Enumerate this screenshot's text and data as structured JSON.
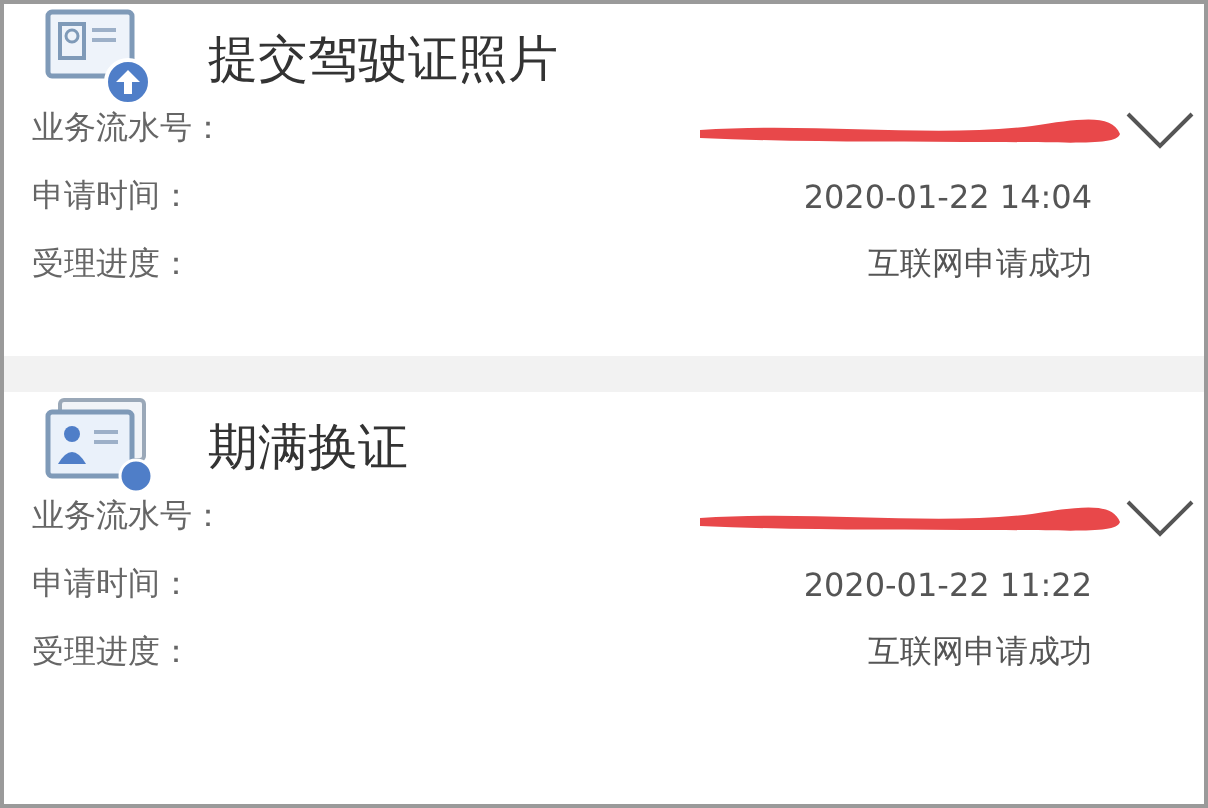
{
  "records": [
    {
      "kind": "upload",
      "title": "提交驾驶证照片",
      "expanded": false,
      "fields": [
        {
          "label": "业务流水号：",
          "value_hidden": true
        },
        {
          "label": "申请时间：",
          "value": "2020-01-22 14:04"
        },
        {
          "label": "受理进度：",
          "value": "互联网申请成功"
        }
      ]
    },
    {
      "kind": "renew",
      "title": "期满换证",
      "expanded": false,
      "fields": [
        {
          "label": "业务流水号：",
          "value_hidden": true
        },
        {
          "label": "申请时间：",
          "value": "2020-01-22 11:22"
        },
        {
          "label": "受理进度：",
          "value": "互联网申请成功"
        }
      ]
    }
  ]
}
